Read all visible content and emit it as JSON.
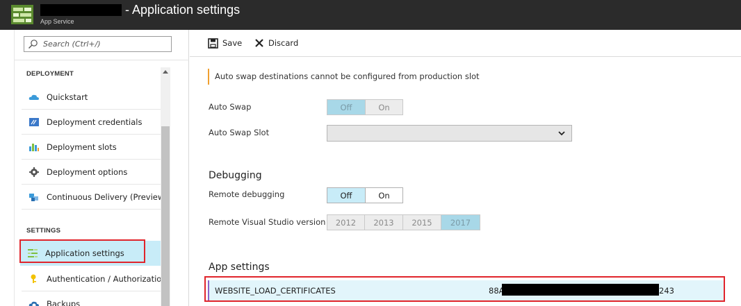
{
  "header": {
    "title": "- Application settings",
    "subtitle": "App Service"
  },
  "sidebar": {
    "search_placeholder": "Search (Ctrl+/)",
    "sections": [
      {
        "label": "DEPLOYMENT",
        "items": [
          {
            "label": "Quickstart",
            "icon": "cloud-icon"
          },
          {
            "label": "Deployment credentials",
            "icon": "credentials-icon"
          },
          {
            "label": "Deployment slots",
            "icon": "slots-icon"
          },
          {
            "label": "Deployment options",
            "icon": "gear-icon"
          },
          {
            "label": "Continuous Delivery (Preview)",
            "icon": "cubes-icon"
          }
        ]
      },
      {
        "label": "SETTINGS",
        "items": [
          {
            "label": "Application settings",
            "icon": "settings-list-icon",
            "selected": true
          },
          {
            "label": "Authentication / Authorization",
            "icon": "key-icon"
          },
          {
            "label": "Backups",
            "icon": "backup-cloud-icon"
          }
        ]
      }
    ]
  },
  "toolbar": {
    "save_label": "Save",
    "discard_label": "Discard"
  },
  "main": {
    "warning": "Auto swap destinations cannot be configured from production slot",
    "auto_swap": {
      "label": "Auto Swap",
      "options": [
        "Off",
        "On"
      ],
      "selected": "Off",
      "enabled": false
    },
    "auto_swap_slot": {
      "label": "Auto Swap Slot",
      "value": ""
    },
    "debugging": {
      "heading": "Debugging",
      "remote_debugging": {
        "label": "Remote debugging",
        "options": [
          "Off",
          "On"
        ],
        "selected": "Off"
      },
      "vs_version": {
        "label": "Remote Visual Studio version",
        "options": [
          "2012",
          "2013",
          "2015",
          "2017"
        ],
        "selected": "2017",
        "enabled": false
      }
    },
    "app_settings": {
      "heading": "App settings",
      "rows": [
        {
          "name": "WEBSITE_LOAD_CERTIFICATES",
          "value_prefix": "88A",
          "value_suffix": "243"
        }
      ]
    }
  },
  "colors": {
    "header_bg": "#2b2b2b",
    "selected_bg": "#c8ecf8",
    "highlight_outline": "#e0242b",
    "warning_accent": "#f0a030"
  }
}
